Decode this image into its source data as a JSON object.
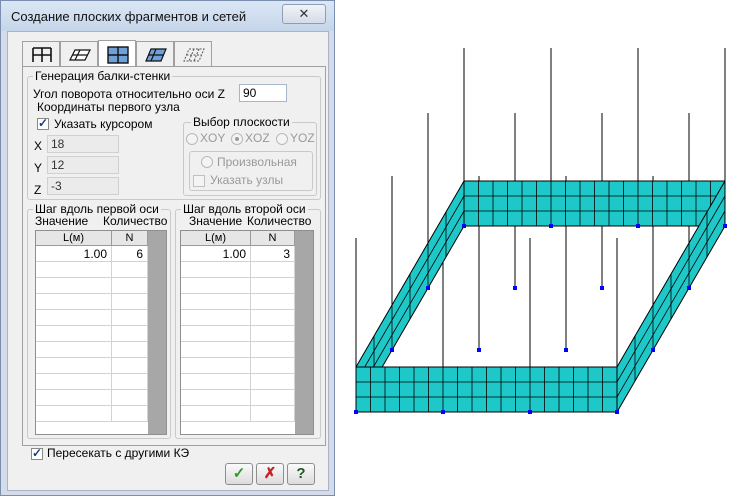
{
  "dialog": {
    "title": "Создание плоских фрагментов и сетей",
    "close_label": "✕",
    "tabs": [
      {
        "icon": "grid-frame-icon",
        "active": false
      },
      {
        "icon": "plate-slanted-icon",
        "active": false
      },
      {
        "icon": "wall-grid-icon",
        "active": true
      },
      {
        "icon": "plate-grid-icon",
        "active": false
      },
      {
        "icon": "dashed-mesh-icon",
        "active": false
      }
    ],
    "generation_group": "Генерация балки-стенки",
    "rotation_label": "Угол поворота относительно оси Z",
    "rotation_value": "90",
    "first_node_label": "Координаты первого узла",
    "cursor_checkbox_label": "Указать курсором",
    "coords": [
      {
        "axis": "X",
        "value": "18"
      },
      {
        "axis": "Y",
        "value": "12"
      },
      {
        "axis": "Z",
        "value": "-3"
      }
    ],
    "plane_group": "Выбор плоскости",
    "planes": [
      {
        "label": "XOY",
        "selected": false
      },
      {
        "label": "XOZ",
        "selected": true
      },
      {
        "label": "YOZ",
        "selected": false
      }
    ],
    "arbitrary_label": "Произвольная",
    "specify_nodes_label": "Указать узлы",
    "axis1": {
      "title": "Шаг вдоль первой оси",
      "col_value": "Значение",
      "col_count": "Количество",
      "headers": [
        "L(м)",
        "N"
      ],
      "rows": [
        [
          "1.00",
          "6"
        ]
      ]
    },
    "axis2": {
      "title": "Шаг вдоль второй оси",
      "col_value": "Значение",
      "col_count": "Количество",
      "headers": [
        "L(м)",
        "N"
      ],
      "rows": [
        [
          "1.00",
          "3"
        ]
      ]
    },
    "intersect_label": "Пересекать с другими КЭ",
    "buttons": [
      {
        "name": "ok-button",
        "icon": "checkmark-icon",
        "symbol": "✓",
        "color": "#2e9b2e"
      },
      {
        "name": "cancel-button",
        "icon": "cross-icon",
        "symbol": "✗",
        "color": "#c62020"
      },
      {
        "name": "help-button",
        "icon": "question-icon",
        "symbol": "?",
        "color": "#1a5a1a"
      }
    ]
  },
  "colors": {
    "mesh_fill": "#1ec8c8",
    "mesh_line": "#000000",
    "node": "#0000ff"
  }
}
